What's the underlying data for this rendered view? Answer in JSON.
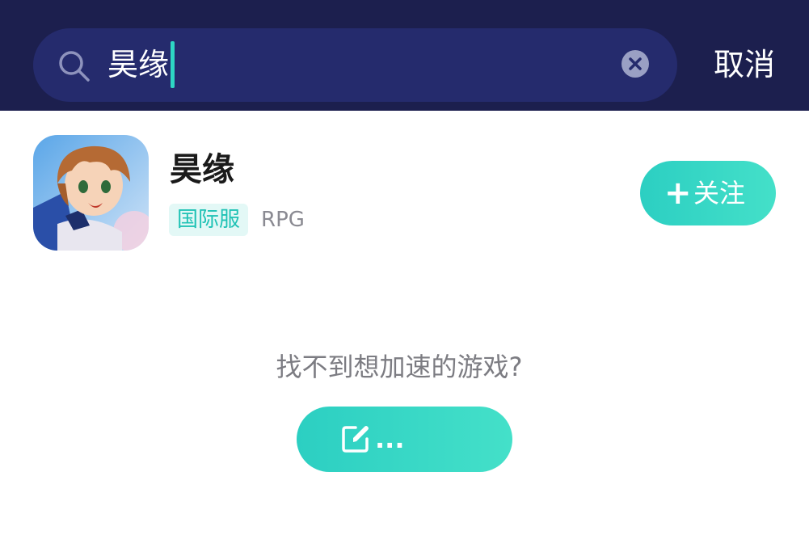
{
  "search": {
    "query": "昊缘",
    "cancel_label": "取消",
    "icons": {
      "search": "search-icon",
      "clear": "clear-icon"
    }
  },
  "result": {
    "title": "昊缘",
    "region_tag": "国际服",
    "genre_tag": "RPG",
    "follow_label": "关注",
    "icons": {
      "follow": "plus-icon"
    }
  },
  "empty_state": {
    "hint": "找不到想加速的游戏?",
    "feedback_label": "...",
    "icons": {
      "feedback": "edit-icon"
    }
  },
  "colors": {
    "header_bg": "#1c1f4e",
    "search_bg": "#252b6d",
    "accent": "#2ccfc2",
    "tag_bg": "#e3f8f6",
    "tag_text": "#1fc2b5"
  }
}
